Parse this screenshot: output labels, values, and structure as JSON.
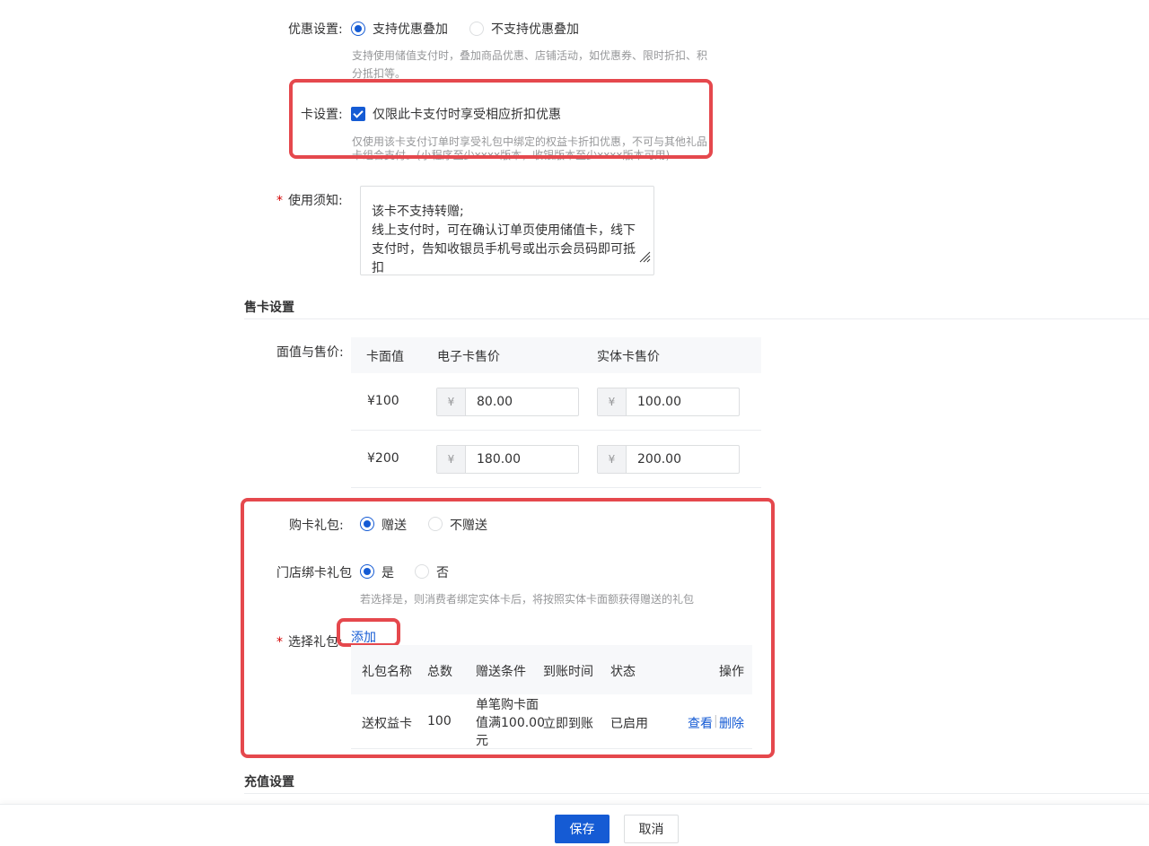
{
  "discount": {
    "label": "优惠设置:",
    "options": [
      "支持优惠叠加",
      "不支持优惠叠加"
    ],
    "help_lines": [
      "支持使用储值支付时，叠加商品优惠、店铺活动，如优惠券、限时折扣、积",
      "分抵扣等。"
    ]
  },
  "card": {
    "label": "卡设置:",
    "checkbox_label": "仅限此卡支付时享受相应折扣优惠",
    "help_lines": [
      "仅使用该卡支付订单时享受礼包中绑定的权益卡折扣优惠，不可与其他礼品",
      "卡组合支付。(小程序至少xxxx版本，收银版本至少xxxx版本可用)"
    ]
  },
  "notice": {
    "label": "使用须知:",
    "required_mark": "*",
    "text": "该卡不支持转赠;\n线上支付时，可在确认订单页使用储值卡，线下支付时，告知收银员手机号或出示会员码即可抵扣"
  },
  "sale_section": {
    "title": "售卡设置",
    "price_label": "面值与售价:",
    "columns": [
      "卡面值",
      "电子卡售价",
      "实体卡售价"
    ],
    "currency": "¥",
    "rows": [
      {
        "face": "¥100",
        "e_price": "80.00",
        "physical_price": "100.00"
      },
      {
        "face": "¥200",
        "e_price": "180.00",
        "physical_price": "200.00"
      }
    ]
  },
  "gift": {
    "label": "购卡礼包:",
    "options": [
      "赠送",
      "不赠送"
    ],
    "store_label": "门店绑卡礼包",
    "store_options": [
      "是",
      "否"
    ],
    "store_help": "若选择是，则消费者绑定实体卡后，将按照实体卡面额获得赠送的礼包",
    "select_label": "选择礼包:",
    "required_mark": "*",
    "add_link": "添加",
    "columns": [
      "礼包名称",
      "总数",
      "赠送条件",
      "到账时间",
      "状态",
      "操作"
    ],
    "rows": [
      {
        "name": "送权益卡",
        "total": "100",
        "condition": [
          "单笔购卡面",
          "值满100.00",
          "元"
        ],
        "arrival": "立即到账",
        "status": "已启用",
        "view": "查看",
        "sep": "|",
        "delete": "删除"
      }
    ]
  },
  "recharge_section": {
    "title": "充值设置"
  },
  "footer": {
    "save": "保存",
    "cancel": "取消"
  },
  "colors": {
    "primary": "#155bd4",
    "highlight": "#e5484d"
  }
}
